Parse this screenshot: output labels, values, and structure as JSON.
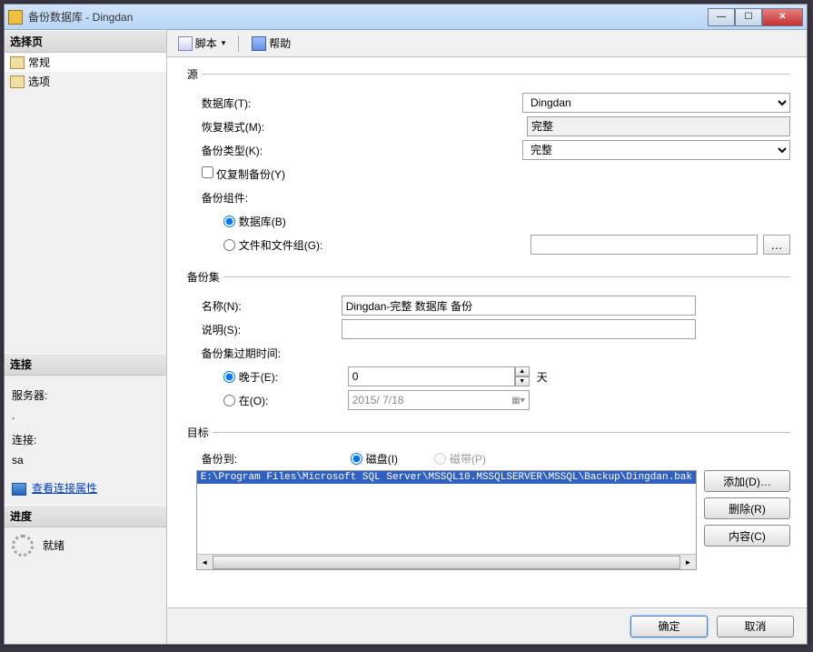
{
  "window": {
    "title": "备份数据库 - Dingdan"
  },
  "sidebar": {
    "pages_header": "选择页",
    "pages": [
      {
        "label": "常规"
      },
      {
        "label": "选项"
      }
    ],
    "conn_header": "连接",
    "server_label": "服务器:",
    "server_value": ".",
    "conn_label": "连接:",
    "conn_value": "sa",
    "view_props": "查看连接属性",
    "progress_header": "进度",
    "progress_status": "就绪"
  },
  "toolbar": {
    "script": "脚本",
    "help": "帮助"
  },
  "src": {
    "legend": "源",
    "db_label": "数据库(T):",
    "db_value": "Dingdan",
    "recovery_label": "恢复模式(M):",
    "recovery_value": "完整",
    "type_label": "备份类型(K):",
    "type_value": "完整",
    "copy_only": "仅复制备份(Y)",
    "component_label": "备份组件:",
    "radio_db": "数据库(B)",
    "radio_fg": "文件和文件组(G):"
  },
  "set": {
    "legend": "备份集",
    "name_label": "名称(N):",
    "name_value": "Dingdan-完整 数据库 备份",
    "desc_label": "说明(S):",
    "desc_value": "",
    "expire_label": "备份集过期时间:",
    "after_label": "晚于(E):",
    "after_value": "0",
    "after_unit": "天",
    "on_label": "在(O):",
    "on_value": "2015/ 7/18"
  },
  "dest": {
    "legend": "目标",
    "backup_to": "备份到:",
    "disk": "磁盘(I)",
    "tape": "磁带(P)",
    "path": "E:\\Program Files\\Microsoft SQL Server\\MSSQL10.MSSQLSERVER\\MSSQL\\Backup\\Dingdan.bak",
    "add": "添加(D)…",
    "remove": "删除(R)",
    "contents": "内容(C)"
  },
  "footer": {
    "ok": "确定",
    "cancel": "取消"
  }
}
